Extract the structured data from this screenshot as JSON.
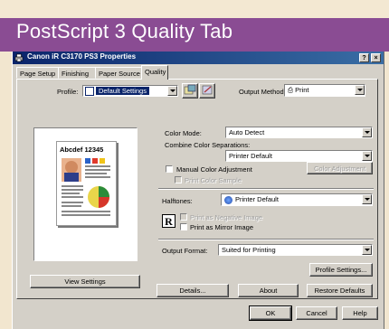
{
  "banner": {
    "title": "PostScript 3 Quality Tab"
  },
  "window": {
    "title": "Canon iR C3170 PS3 Properties",
    "help_btn": "?",
    "close_btn": "×"
  },
  "tabs": [
    "Page Setup",
    "Finishing",
    "Paper Source",
    "Quality"
  ],
  "profile": {
    "label": "Profile:",
    "value": "Default Settings"
  },
  "output_method": {
    "label": "Output Method:",
    "value": "Print"
  },
  "preview": {
    "sample_text": "Abcdef 12345",
    "view_settings": "View Settings"
  },
  "color_mode": {
    "label": "Color Mode:",
    "value": "Auto Detect"
  },
  "combine": {
    "label": "Combine Color Separations:",
    "value": "Printer Default"
  },
  "manual_color": {
    "label": "Manual Color Adjustment",
    "button": "Color Adjustment"
  },
  "print_color_sample": {
    "label": "Print Color Sample"
  },
  "halftones": {
    "label": "Halftones:",
    "value": "Printer Default"
  },
  "negative": {
    "label": "Print as Negative Image"
  },
  "mirror": {
    "label": "Print as Mirror Image"
  },
  "mirror_icon_letter": "R",
  "output_format": {
    "label": "Output Format:",
    "value": "Suited for Printing"
  },
  "buttons": {
    "profile_settings": "Profile Settings...",
    "details": "Details...",
    "about": "About",
    "restore": "Restore Defaults",
    "ok": "OK",
    "cancel": "Cancel",
    "help": "Help"
  },
  "colors": {
    "banner_purple": "#8a4c93",
    "titlebar": "#0a246a",
    "dialog_face": "#d4d0c8"
  }
}
